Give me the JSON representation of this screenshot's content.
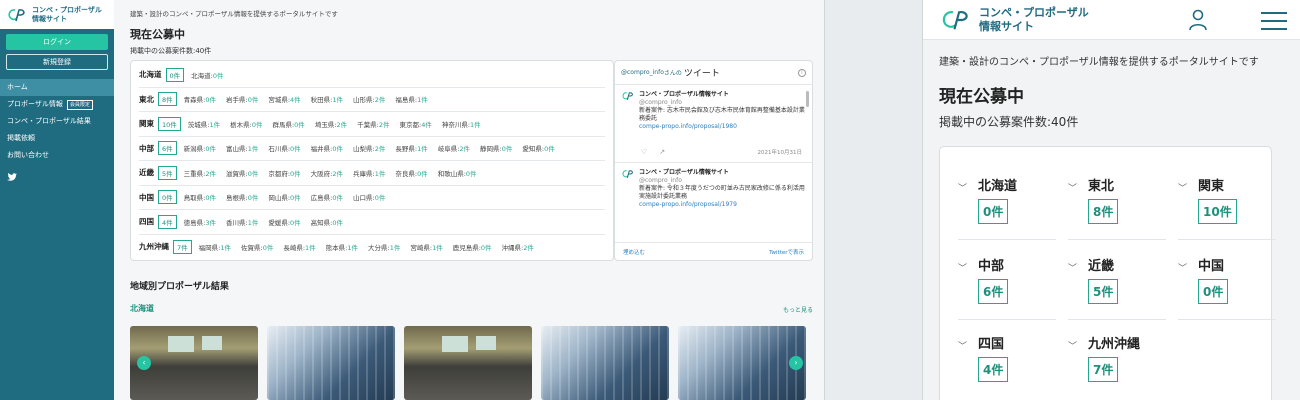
{
  "site": {
    "logo_line1": "コンペ・プロポーザル",
    "logo_line2": "情報サイト"
  },
  "sidebar": {
    "login": "ログイン",
    "register": "新規登録",
    "items": [
      {
        "label": "ホーム"
      },
      {
        "label": "プロポーザル情報",
        "badge": "会員限定"
      },
      {
        "label": "コンペ・プロポーザル結果"
      },
      {
        "label": "掲載依頼"
      },
      {
        "label": "お問い合わせ"
      }
    ]
  },
  "main": {
    "tagline": "建築・設計のコンペ・プロポーザル情報を提供するポータルサイトです",
    "heading": "現在公募中",
    "count": "掲載中の公募案件数:40件",
    "regions": [
      {
        "name": "北海道",
        "badge": "0件",
        "prefs": [
          [
            "北海道:",
            "0件"
          ]
        ]
      },
      {
        "name": "東北",
        "badge": "8件",
        "prefs": [
          [
            "青森県:",
            "0件"
          ],
          [
            "岩手県:",
            "0件"
          ],
          [
            "宮城県:",
            "4件"
          ],
          [
            "秋田県:",
            "1件"
          ],
          [
            "山形県:",
            "2件"
          ],
          [
            "福島県:",
            "1件"
          ]
        ]
      },
      {
        "name": "関東",
        "badge": "10件",
        "prefs": [
          [
            "茨城県:",
            "1件"
          ],
          [
            "栃木県:",
            "0件"
          ],
          [
            "群馬県:",
            "0件"
          ],
          [
            "埼玉県:",
            "2件"
          ],
          [
            "千葉県:",
            "2件"
          ],
          [
            "東京都:",
            "4件"
          ],
          [
            "神奈川県:",
            "1件"
          ]
        ]
      },
      {
        "name": "中部",
        "badge": "6件",
        "prefs": [
          [
            "新潟県:",
            "0件"
          ],
          [
            "富山県:",
            "1件"
          ],
          [
            "石川県:",
            "0件"
          ],
          [
            "福井県:",
            "0件"
          ],
          [
            "山梨県:",
            "2件"
          ],
          [
            "長野県:",
            "1件"
          ],
          [
            "岐阜県:",
            "2件"
          ],
          [
            "静岡県:",
            "0件"
          ],
          [
            "愛知県:",
            "0件"
          ]
        ]
      },
      {
        "name": "近畿",
        "badge": "5件",
        "prefs": [
          [
            "三重県:",
            "2件"
          ],
          [
            "滋賀県:",
            "0件"
          ],
          [
            "京都府:",
            "0件"
          ],
          [
            "大阪府:",
            "2件"
          ],
          [
            "兵庫県:",
            "1件"
          ],
          [
            "奈良県:",
            "0件"
          ],
          [
            "和歌山県:",
            "0件"
          ]
        ]
      },
      {
        "name": "中国",
        "badge": "0件",
        "prefs": [
          [
            "鳥取県:",
            "0件"
          ],
          [
            "島根県:",
            "0件"
          ],
          [
            "岡山県:",
            "0件"
          ],
          [
            "広島県:",
            "0件"
          ],
          [
            "山口県:",
            "0件"
          ]
        ]
      },
      {
        "name": "四国",
        "badge": "4件",
        "prefs": [
          [
            "徳島県:",
            "3件"
          ],
          [
            "香川県:",
            "1件"
          ],
          [
            "愛媛県:",
            "0件"
          ],
          [
            "高知県:",
            "0件"
          ]
        ]
      },
      {
        "name": "九州沖縄",
        "badge": "7件",
        "prefs": [
          [
            "福岡県:",
            "1件"
          ],
          [
            "佐賀県:",
            "0件"
          ],
          [
            "長崎県:",
            "1件"
          ],
          [
            "熊本県:",
            "1件"
          ],
          [
            "大分県:",
            "1件"
          ],
          [
            "宮崎県:",
            "1件"
          ],
          [
            "鹿児島県:",
            "0件"
          ],
          [
            "沖縄県:",
            "2件"
          ]
        ]
      }
    ],
    "twitter": {
      "handle_prefix": "@compro_info",
      "handle_suffix": "さんの",
      "title": "ツイート",
      "tweets": [
        {
          "name": "コンペ・プロポーザル情報サイト",
          "handle": "@compro_info",
          "text": "新着案件: 志木市民会館及び志木市民体育館再整備基本設計業務委託",
          "link": "compe-propo.info/proposal/1980",
          "date": "2021年10月31日"
        },
        {
          "name": "コンペ・プロポーザル情報サイト",
          "handle": "@compro_info",
          "text": "新着案件: 令和３年度うだつの町並み古民家改修に係る利活用実施設計委託業務",
          "link": "compe-propo.info/proposal/1979",
          "date": ""
        }
      ],
      "embed": "埋め込む",
      "view": "Twitterで表示"
    },
    "results_heading": "地域別プロポーザル結果",
    "results_region": "北海道",
    "more": "もっと見る"
  },
  "mobile": {
    "tagline": "建築・設計のコンペ・プロポーザル情報を提供するポータルサイトです",
    "heading": "現在公募中",
    "count": "掲載中の公募案件数:40件",
    "regions": [
      {
        "name": "北海道",
        "badge": "0件"
      },
      {
        "name": "東北",
        "badge": "8件"
      },
      {
        "name": "関東",
        "badge": "10件"
      },
      {
        "name": "中部",
        "badge": "6件"
      },
      {
        "name": "近畿",
        "badge": "5件"
      },
      {
        "name": "中国",
        "badge": "0件"
      },
      {
        "name": "四国",
        "badge": "4件"
      },
      {
        "name": "九州沖縄",
        "badge": "7件"
      }
    ]
  },
  "colors": {
    "brand": "#1f6b80",
    "accent": "#25c4a3",
    "count": "#25a891"
  }
}
